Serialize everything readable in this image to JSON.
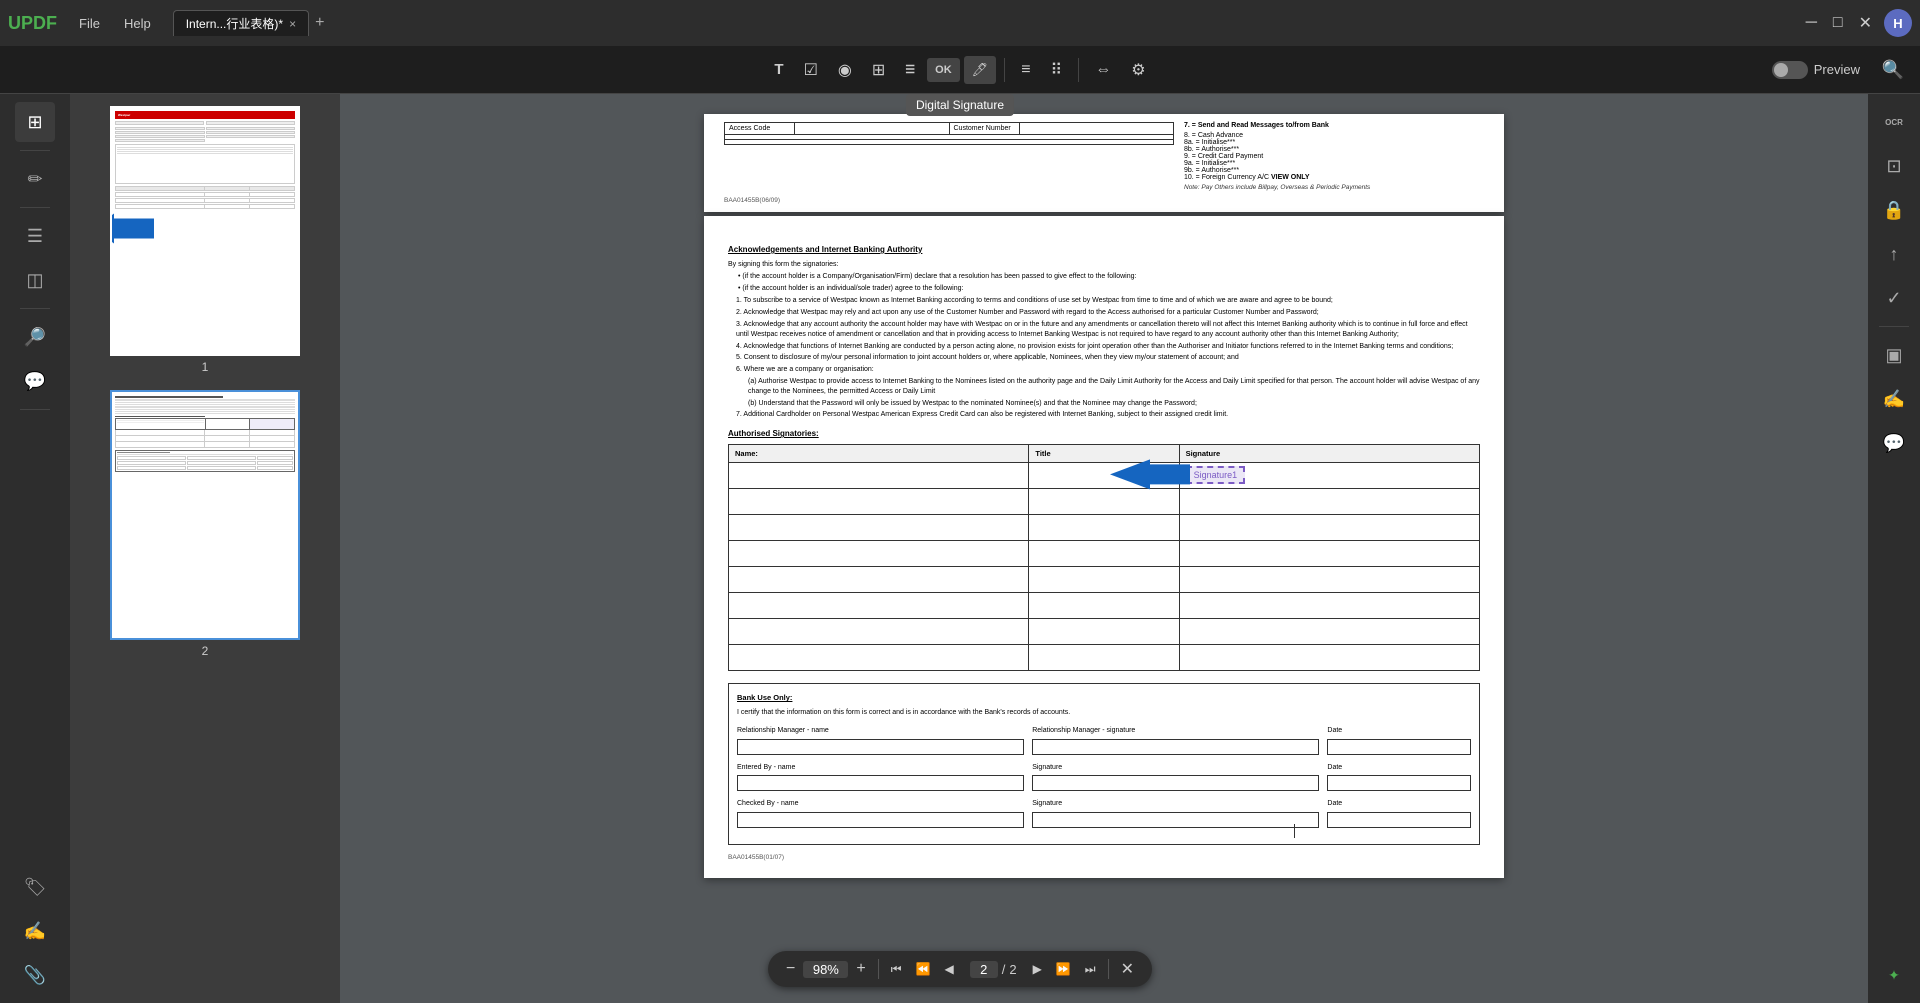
{
  "app": {
    "logo": "UPDF",
    "menu": [
      "File",
      "Help"
    ],
    "tab_label": "Intern...行业表格)*",
    "tab_close": "×",
    "tab_add": "+",
    "avatar_initial": "H"
  },
  "toolbar": {
    "tools": [
      {
        "id": "text-tool",
        "icon": "T",
        "label": "Text"
      },
      {
        "id": "checkbox-tool",
        "icon": "☑",
        "label": "Checkbox"
      },
      {
        "id": "radio-tool",
        "icon": "◉",
        "label": "Radio"
      },
      {
        "id": "table-tool",
        "icon": "⊞",
        "label": "Table"
      },
      {
        "id": "list-tool",
        "icon": "☰",
        "label": "List"
      },
      {
        "id": "ok-tool",
        "icon": "OK",
        "label": "OK"
      },
      {
        "id": "sig-tool",
        "icon": "🖊",
        "label": "Digital Signature",
        "active": true
      },
      {
        "id": "sep1",
        "type": "separator"
      },
      {
        "id": "tool-2",
        "icon": "≡",
        "label": "Tool 2"
      },
      {
        "id": "tool-3",
        "icon": "⊞⊞",
        "label": "Tool 3"
      },
      {
        "id": "sep2",
        "type": "separator"
      },
      {
        "id": "align-tool",
        "icon": "⇔",
        "label": "Align"
      },
      {
        "id": "settings-tool",
        "icon": "⚙",
        "label": "Settings"
      }
    ],
    "digital_signature_tooltip": "Digital Signature",
    "preview_label": "Preview"
  },
  "sidebar": {
    "icons": [
      {
        "id": "pages",
        "icon": "⊞",
        "active": true
      },
      {
        "id": "sep1",
        "type": "separator"
      },
      {
        "id": "edit",
        "icon": "✏"
      },
      {
        "id": "sep2",
        "type": "separator"
      },
      {
        "id": "bookmark",
        "icon": "☰"
      },
      {
        "id": "layers",
        "icon": "◫"
      },
      {
        "id": "sep3",
        "type": "separator"
      },
      {
        "id": "search2",
        "icon": "🔎"
      },
      {
        "id": "comments",
        "icon": "💬"
      },
      {
        "id": "sep4",
        "type": "separator"
      },
      {
        "id": "stamp",
        "icon": "🏷"
      },
      {
        "id": "sign",
        "icon": "✍"
      },
      {
        "id": "attachment",
        "icon": "📎"
      }
    ]
  },
  "thumbnails": [
    {
      "page": 1,
      "label": "1",
      "selected": false
    },
    {
      "page": 2,
      "label": "2",
      "selected": true
    }
  ],
  "document": {
    "page1_content": "Westpac Internet Banking Access Authority",
    "page2_content": "Acknowledgements and Internet Banking Authority",
    "file_code1": "BAA01455B(06/09)",
    "file_code2": "BAA01455B(01/07)"
  },
  "bank_section": {
    "title": "Bank Use Only:",
    "certify_text": "I certify that the information on this form is correct and is in accordance with the Bank's records of accounts.",
    "fields": [
      {
        "label": "Relationship Manager - name",
        "type": "text",
        "width": "large"
      },
      {
        "label": "Relationship Manager - signature",
        "type": "signature",
        "width": "large"
      },
      {
        "label": "Date",
        "type": "date"
      },
      {
        "label": "Entered By - name",
        "type": "text",
        "width": "large"
      },
      {
        "label": "Signature",
        "type": "signature",
        "width": "large"
      },
      {
        "label": "Date",
        "type": "date"
      },
      {
        "label": "Checked By - name",
        "type": "text",
        "width": "large"
      },
      {
        "label": "Signature",
        "type": "signature",
        "width": "large"
      },
      {
        "label": "Date",
        "type": "date"
      }
    ]
  },
  "bottom_toolbar": {
    "zoom_minus": "−",
    "zoom_level": "98%",
    "zoom_plus": "+",
    "page_first": "⏮",
    "page_prev_double": "⏪",
    "page_prev": "◀",
    "current_page": "2",
    "page_separator": "/",
    "total_pages": "2",
    "page_next": "▶",
    "page_next_double": "⏩",
    "page_last": "⏭",
    "close": "✕"
  },
  "right_sidebar": {
    "icons": [
      {
        "id": "ocr",
        "icon": "OCR"
      },
      {
        "id": "compress",
        "icon": "⊡"
      },
      {
        "id": "protect",
        "icon": "🔒"
      },
      {
        "id": "export",
        "icon": "↑"
      },
      {
        "id": "check",
        "icon": "✓"
      },
      {
        "id": "sep1",
        "type": "separator"
      },
      {
        "id": "layout",
        "icon": "▣"
      },
      {
        "id": "sign2",
        "icon": "✍"
      },
      {
        "id": "chat",
        "icon": "💬"
      },
      {
        "id": "updf-ai",
        "icon": "✦"
      }
    ]
  },
  "acknowledgements": {
    "title": "Acknowledgements and Internet Banking Authority",
    "intro": "By signing this form the signatories:",
    "bullets": [
      "(if the account holder is a Company/Organisation/Firm) declare that a resolution has been passed to give effect to the following:",
      "(if the account holder is an individual/sole trader) agree to the following:"
    ],
    "items": [
      "To subscribe to a service of Westpac known as Internet Banking according to terms and conditions of use set by Westpac from time to time and of which we are aware and agree to be bound;",
      "Acknowledge that Westpac may rely and act upon any use of the Customer Number and Password with regard to the Access authorised for a particular Customer Number and Password;",
      "Acknowledge that any account authority the account holder may have with Westpac on or in the future and any amendments or cancellation thereto will not affect this Internet Banking authority which is to continue in full force and effect until Westpac receives notice of amendment or cancellation and that in providing access to Internet Banking Westpac is not required to have regard to any account authority other than this Internet Banking Authority;",
      "Acknowledge that functions of Internet Banking are conducted by a person acting alone, no provision exists for joint operation other than the Authoriser and Initiator functions referred to in the Internet Banking terms and conditions;",
      "Consent to disclosure of my/our personal information to joint account holders or, where applicable, Nominees, when they view my/our statement of account; and",
      "Where we are a company or organisation:",
      "(a) Authorise Westpac to provide access to Internet Banking to the Nominees listed on the authority page and the Daily Limit Authority for the Access and Daily Limit specified for that person. The account holder will advise Westpac of any change to the Nominees, the permitted Access or Daily Limit",
      "(b) Understand that the Password will only be issued by Westpac to the nominated Nominee(s) and that the Nominee may change the Password;",
      "Additional Cardholder on Personal Westpac American Express Credit Card can also be registered with Internet Banking, subject to their assigned credit limit."
    ]
  },
  "authorised_signatories": {
    "title": "Authorised Signatories:",
    "columns": [
      "Name:",
      "Title",
      "Signature"
    ],
    "rows": 8,
    "signature1_label": "Signature1"
  },
  "arrow_annotation": {
    "color": "#1565C0",
    "direction": "right"
  },
  "items_list": {
    "right_col": [
      "7. = Send and Read Messages to/from Bank",
      "8. = Cash Advance",
      "8a. = Initialise***",
      "8b. = Authorise***",
      "9. = Credit Card Payment",
      "9a. = Initialise***",
      "9b. = Authorise***",
      "10. = Foreign Currency A/C VIEW ONLY"
    ],
    "note": "Note: Pay Others include Billpay, Overseas & Periodic Payments"
  }
}
